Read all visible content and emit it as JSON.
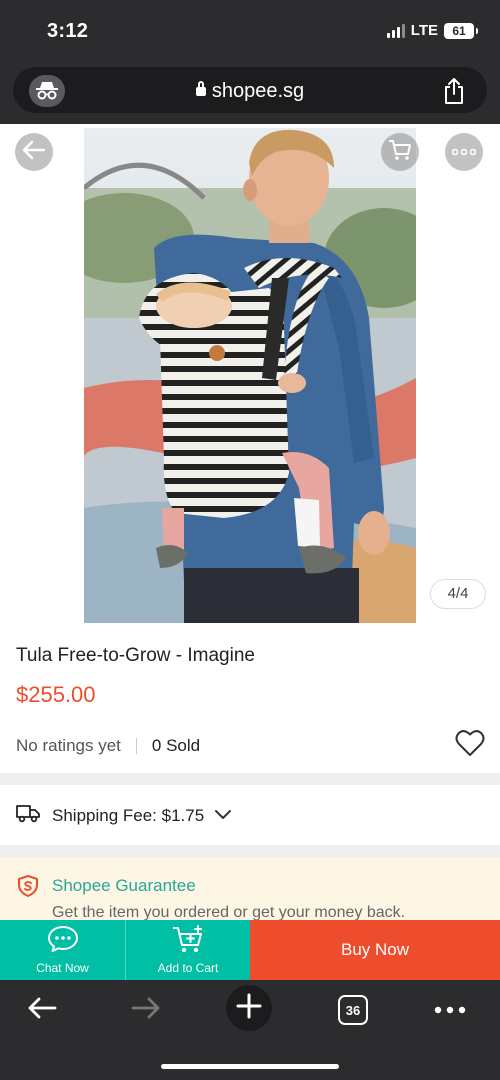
{
  "status_bar": {
    "time": "3:12",
    "network": "LTE",
    "battery": "61"
  },
  "browser": {
    "url": "shopee.sg",
    "tab_count": "36"
  },
  "gallery": {
    "counter": "4/4"
  },
  "product": {
    "title": "Tula Free-to-Grow - Imagine",
    "price": "$255.00",
    "ratings": "No ratings yet",
    "sold": "0 Sold"
  },
  "shipping": {
    "label": "Shipping Fee: $1.75"
  },
  "guarantee": {
    "title": "Shopee Guarantee",
    "subtitle": "Get the item you ordered or get your money back."
  },
  "actions": {
    "chat_label": "Chat Now",
    "add_to_cart_label": "Add to Cart",
    "buy_now_label": "Buy Now"
  },
  "icons": {
    "back": "back-arrow-icon",
    "cart": "cart-icon",
    "more": "more-icon",
    "heart": "heart-icon",
    "truck": "truck-icon",
    "shield": "shield-icon",
    "chat": "chat-icon",
    "add_cart": "add-cart-icon",
    "share": "share-icon",
    "incognito": "incognito-icon"
  },
  "colors": {
    "brand": "#ee4d2d",
    "teal": "#00bfa5",
    "guarantee_bg": "#fdf6e4",
    "chrome": "#2c2c2e"
  }
}
